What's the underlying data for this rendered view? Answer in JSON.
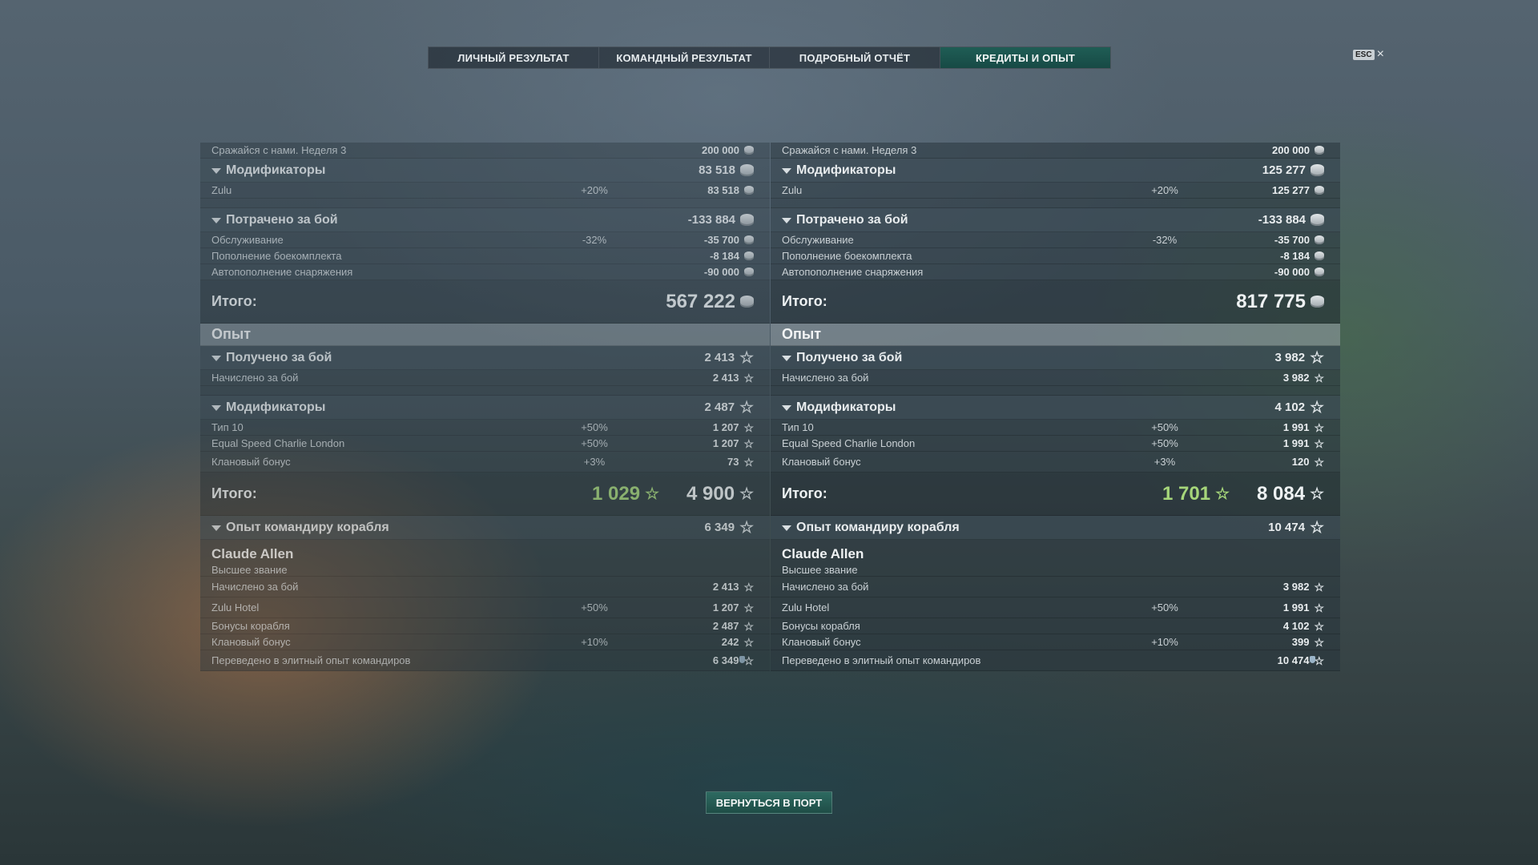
{
  "tabs": [
    {
      "label": "ЛИЧНЫЙ РЕЗУЛЬТАТ"
    },
    {
      "label": "КОМАНДНЫЙ РЕЗУЛЬТАТ"
    },
    {
      "label": "ПОДРОБНЫЙ ОТЧЁТ"
    },
    {
      "label": "КРЕДИТЫ И ОПЫТ"
    }
  ],
  "active_tab": "КРЕДИТЫ И ОПЫТ",
  "esc": {
    "key": "ESC",
    "close": "×"
  },
  "left": {
    "event": {
      "label": "Сражайся с нами. Неделя 3",
      "value": "200 000"
    },
    "modifiers": {
      "label": "Модификаторы",
      "value": "83 518"
    },
    "zulu": {
      "label": "Zulu",
      "pct": "+20%",
      "value": "83 518"
    },
    "spent": {
      "label": "Потрачено за бой",
      "value": "-133 884"
    },
    "service": {
      "label": "Обслуживание",
      "pct": "-32%",
      "value": "-35 700"
    },
    "ammo": {
      "label": "Пополнение боекомплекта",
      "value": "-8 184"
    },
    "consumables": {
      "label": "Автопополнение снаряжения",
      "value": "-90 000"
    },
    "credits_total": {
      "label": "Итого:",
      "value": "567 222"
    },
    "xp_section": "Опыт",
    "xp_earned": {
      "label": "Получено за бой",
      "value": "2 413"
    },
    "xp_base": {
      "label": "Начислено за бой",
      "value": "2 413"
    },
    "xp_modifiers": {
      "label": "Модификаторы",
      "value": "2 487"
    },
    "tier10": {
      "label": "Тип 10",
      "pct": "+50%",
      "value": "1 207"
    },
    "escl": {
      "label": "Equal Speed Charlie London",
      "pct": "+50%",
      "value": "1 207"
    },
    "clan": {
      "label": "Клановый бонус",
      "pct": "+3%",
      "value": "73"
    },
    "xp_total": {
      "label": "Итого:",
      "free_value": "1 029",
      "value": "4 900"
    },
    "cmd_xp": {
      "label": "Опыт командиру корабля",
      "value": "6 349"
    },
    "commander": {
      "name": "Claude Allen",
      "rank": "Высшее звание"
    },
    "cmd_base": {
      "label": "Начислено за бой",
      "value": "2 413"
    },
    "zulu_hotel": {
      "label": "Zulu Hotel",
      "pct": "+50%",
      "value": "1 207"
    },
    "ship_bonus": {
      "label": "Бонусы корабля",
      "value": "2 487"
    },
    "cmd_clan": {
      "label": "Клановый бонус",
      "pct": "+10%",
      "value": "242"
    },
    "elite": {
      "label": "Переведено в элитный опыт командиров",
      "value": "6 349"
    }
  },
  "right": {
    "event": {
      "label": "Сражайся с нами. Неделя 3",
      "value": "200 000"
    },
    "modifiers": {
      "label": "Модификаторы",
      "value": "125 277"
    },
    "zulu": {
      "label": "Zulu",
      "pct": "+20%",
      "value": "125 277"
    },
    "spent": {
      "label": "Потрачено за бой",
      "value": "-133 884"
    },
    "service": {
      "label": "Обслуживание",
      "pct": "-32%",
      "value": "-35 700"
    },
    "ammo": {
      "label": "Пополнение боекомплекта",
      "value": "-8 184"
    },
    "consumables": {
      "label": "Автопополнение снаряжения",
      "value": "-90 000"
    },
    "credits_total": {
      "label": "Итого:",
      "value": "817 775"
    },
    "xp_section": "Опыт",
    "xp_earned": {
      "label": "Получено за бой",
      "value": "3 982"
    },
    "xp_base": {
      "label": "Начислено за бой",
      "value": "3 982"
    },
    "xp_modifiers": {
      "label": "Модификаторы",
      "value": "4 102"
    },
    "tier10": {
      "label": "Тип 10",
      "pct": "+50%",
      "value": "1 991"
    },
    "escl": {
      "label": "Equal Speed Charlie London",
      "pct": "+50%",
      "value": "1 991"
    },
    "clan": {
      "label": "Клановый бонус",
      "pct": "+3%",
      "value": "120"
    },
    "xp_total": {
      "label": "Итого:",
      "free_value": "1 701",
      "value": "8 084"
    },
    "cmd_xp": {
      "label": "Опыт командиру корабля",
      "value": "10 474"
    },
    "commander": {
      "name": "Claude Allen",
      "rank": "Высшее звание"
    },
    "cmd_base": {
      "label": "Начислено за бой",
      "value": "3 982"
    },
    "zulu_hotel": {
      "label": "Zulu Hotel",
      "pct": "+50%",
      "value": "1 991"
    },
    "ship_bonus": {
      "label": "Бонусы корабля",
      "value": "4 102"
    },
    "cmd_clan": {
      "label": "Клановый бонус",
      "pct": "+10%",
      "value": "399"
    },
    "elite": {
      "label": "Переведено в элитный опыт командиров",
      "value": "10 474"
    }
  },
  "icons": {
    "credits": "coin-icon",
    "xp": "star-icon",
    "elite_xp": "elite-commander-xp-icon"
  },
  "colors": {
    "accent": "#1f5d55",
    "free_xp": "#a6d67a"
  },
  "back_button": "ВЕРНУТЬСЯ В ПОРТ"
}
